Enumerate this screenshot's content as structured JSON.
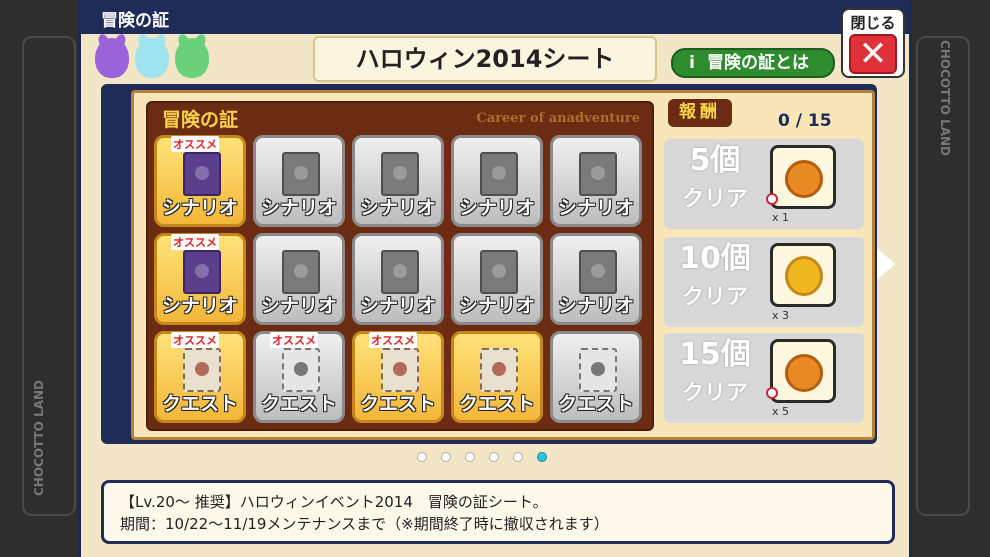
{
  "window": {
    "title": "冒険の証",
    "close_label": "閉じる",
    "close_icon": "close-x-icon"
  },
  "sheet": {
    "title": "ハロウィン2014シート",
    "info_button": "冒険の証とは",
    "info_icon": "i"
  },
  "proof": {
    "title": "冒険の証",
    "subtitle": "Career of anadventure",
    "badge": "オススメ",
    "cells": [
      {
        "label": "シナリオ",
        "type": "book",
        "active": true,
        "recommended": true
      },
      {
        "label": "シナリオ",
        "type": "book",
        "active": false,
        "recommended": false
      },
      {
        "label": "シナリオ",
        "type": "book",
        "active": false,
        "recommended": false
      },
      {
        "label": "シナリオ",
        "type": "book",
        "active": false,
        "recommended": false
      },
      {
        "label": "シナリオ",
        "type": "book",
        "active": false,
        "recommended": false
      },
      {
        "label": "シナリオ",
        "type": "book",
        "active": true,
        "recommended": true
      },
      {
        "label": "シナリオ",
        "type": "book",
        "active": false,
        "recommended": false
      },
      {
        "label": "シナリオ",
        "type": "book",
        "active": false,
        "recommended": false
      },
      {
        "label": "シナリオ",
        "type": "book",
        "active": false,
        "recommended": false
      },
      {
        "label": "シナリオ",
        "type": "book",
        "active": false,
        "recommended": false
      },
      {
        "label": "クエスト",
        "type": "quest",
        "active": true,
        "recommended": true
      },
      {
        "label": "クエスト",
        "type": "quest",
        "active": false,
        "recommended": true
      },
      {
        "label": "クエスト",
        "type": "quest",
        "active": true,
        "recommended": true
      },
      {
        "label": "クエスト",
        "type": "quest",
        "active": true,
        "recommended": false
      },
      {
        "label": "クエスト",
        "type": "quest",
        "active": false,
        "recommended": false
      }
    ]
  },
  "reward": {
    "tag": "報酬",
    "progress": "0 / 15",
    "tiers": [
      {
        "count": "5個",
        "clear": "クリア",
        "qty": "x 1",
        "item_icon": "pie-icon"
      },
      {
        "count": "10個",
        "clear": "クリア",
        "qty": "x 3",
        "item_icon": "pumpkin-icon"
      },
      {
        "count": "15個",
        "clear": "クリア",
        "qty": "x 5",
        "item_icon": "pie-icon"
      }
    ]
  },
  "pagination": {
    "total": 6,
    "active_index": 5
  },
  "description": {
    "line1": "【Lv.20～ 推奨】ハロウィンイベント2014　冒険の証シート。",
    "line2": "期間：10/22～11/19メンテナンスまで（※期間終了時に撤収されます）"
  },
  "side": {
    "label": "CHOCOTTO LAND"
  }
}
